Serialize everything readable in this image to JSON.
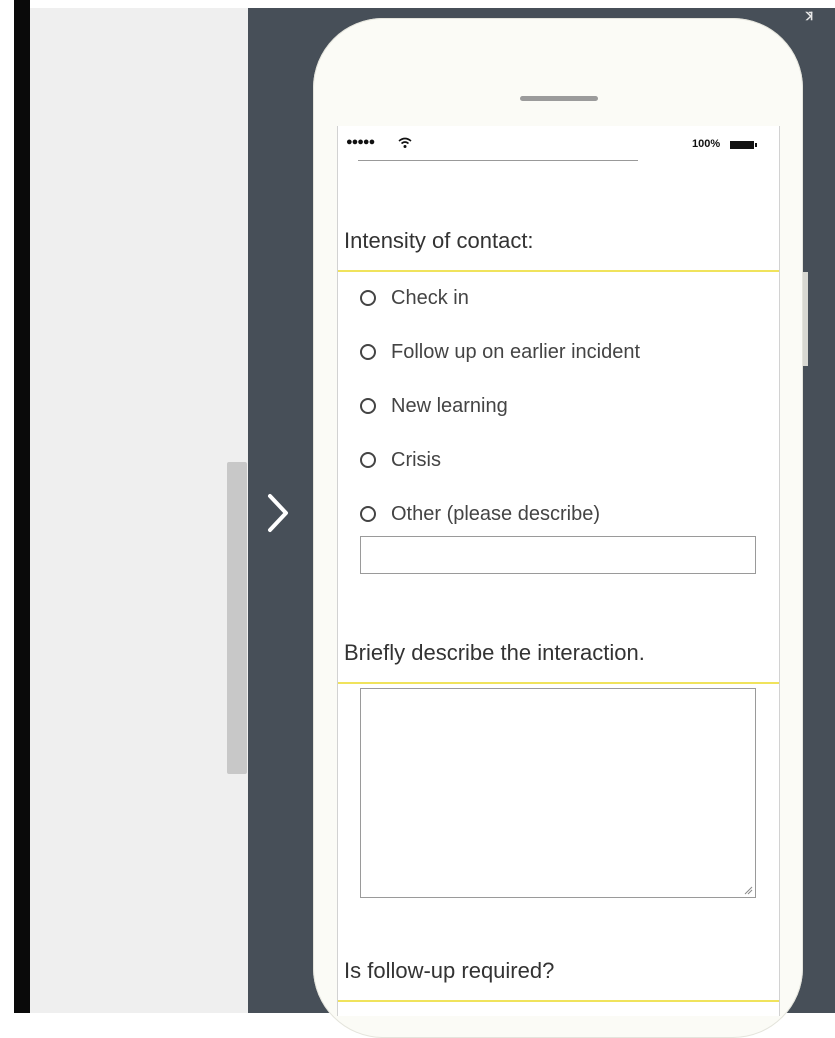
{
  "status_bar": {
    "signal": "●●●●●",
    "wifi_icon": "wifi-icon",
    "battery": "100%"
  },
  "form": {
    "intensity_title": "Intensity of contact:",
    "options": [
      "Check in",
      "Follow up on earlier incident",
      "New learning",
      "Crisis",
      "Other (please describe)"
    ],
    "other_value": "",
    "describe_title": "Briefly describe the interaction.",
    "describe_value": "",
    "followup_title": "Is follow-up required?"
  },
  "colors": {
    "dark_background": "#474f58",
    "accent_rule": "#f0e35c",
    "left_panel": "#efefef"
  },
  "icons": {
    "next": "chevron-right-icon",
    "resize": "resize-grip-icon"
  }
}
